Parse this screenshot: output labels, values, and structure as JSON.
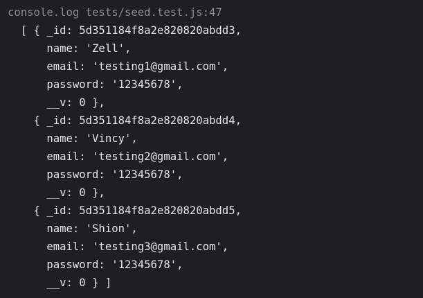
{
  "console": {
    "header": "console.log tests/seed.test.js:47",
    "lines": [
      "  [ { _id: 5d351184f8a2e820820abdd3,",
      "      name: 'Zell',",
      "      email: 'testing1@gmail.com',",
      "      password: '12345678',",
      "      __v: 0 },",
      "    { _id: 5d351184f8a2e820820abdd4,",
      "      name: 'Vincy',",
      "      email: 'testing2@gmail.com',",
      "      password: '12345678',",
      "      __v: 0 },",
      "    { _id: 5d351184f8a2e820820abdd5,",
      "      name: 'Shion',",
      "      email: 'testing3@gmail.com',",
      "      password: '12345678',",
      "      __v: 0 } ]"
    ]
  }
}
